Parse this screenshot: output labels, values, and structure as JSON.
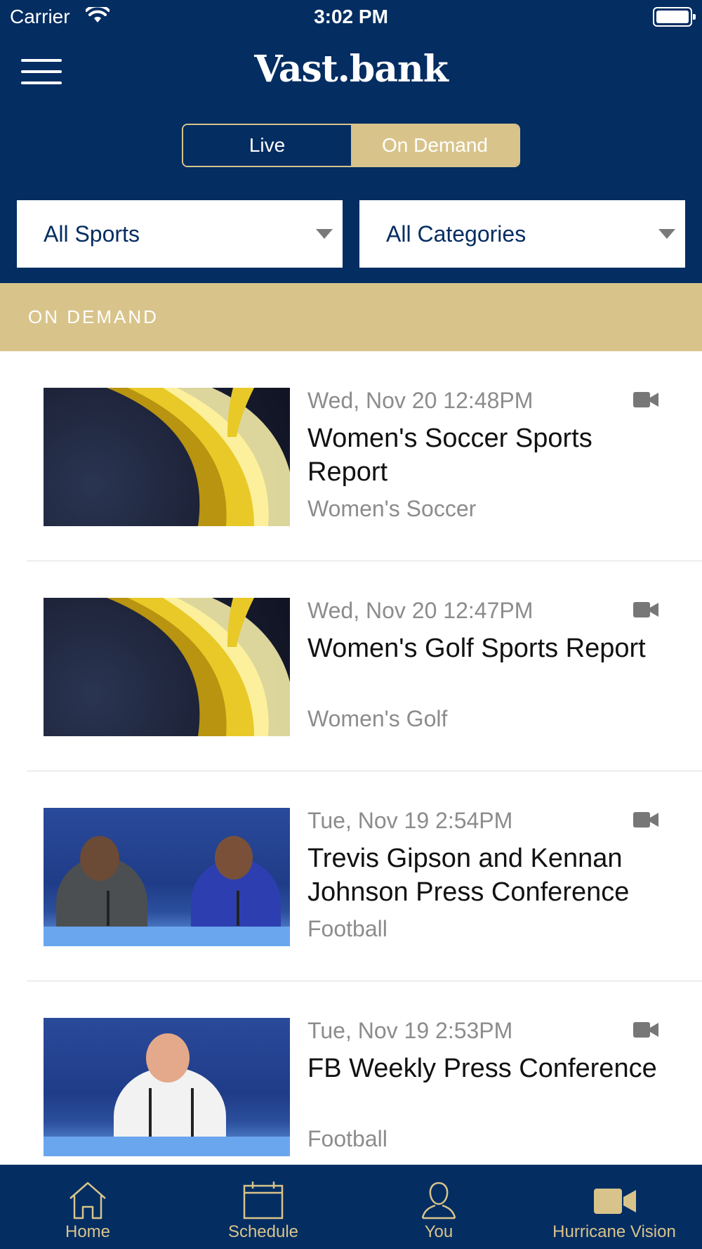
{
  "status_bar": {
    "carrier": "Carrier",
    "time": "3:02 PM"
  },
  "header": {
    "logo": "Vast.bank",
    "segments": [
      {
        "label": "Live",
        "selected": false
      },
      {
        "label": "On Demand",
        "selected": true
      }
    ],
    "filters": {
      "sports": "All Sports",
      "categories": "All Categories"
    }
  },
  "section": {
    "title": "ON DEMAND"
  },
  "videos": [
    {
      "date": "Wed, Nov 20 12:48PM",
      "title": "Women's Soccer Sports Report",
      "sport": "Women's Soccer",
      "thumbnail": "gold-graphic"
    },
    {
      "date": "Wed, Nov 20 12:47PM",
      "title": "Women's Golf Sports Report",
      "sport": "Women's Golf",
      "thumbnail": "gold-graphic"
    },
    {
      "date": "Tue, Nov 19 2:54PM",
      "title": "Trevis Gipson and Kennan Johnson Press Conference",
      "sport": "Football",
      "thumbnail": "press-two"
    },
    {
      "date": "Tue, Nov 19 2:53PM",
      "title": "FB Weekly Press Conference",
      "sport": "Football",
      "thumbnail": "press-one"
    }
  ],
  "tabbar": {
    "items": [
      {
        "label": "Home",
        "icon": "home-icon"
      },
      {
        "label": "Schedule",
        "icon": "calendar-icon"
      },
      {
        "label": "You",
        "icon": "person-icon"
      },
      {
        "label": "Hurricane Vision",
        "icon": "video-camera-icon",
        "active": true
      }
    ]
  },
  "colors": {
    "navy": "#042d62",
    "gold": "#d8c48b",
    "muted_text": "#8c8c8c"
  }
}
